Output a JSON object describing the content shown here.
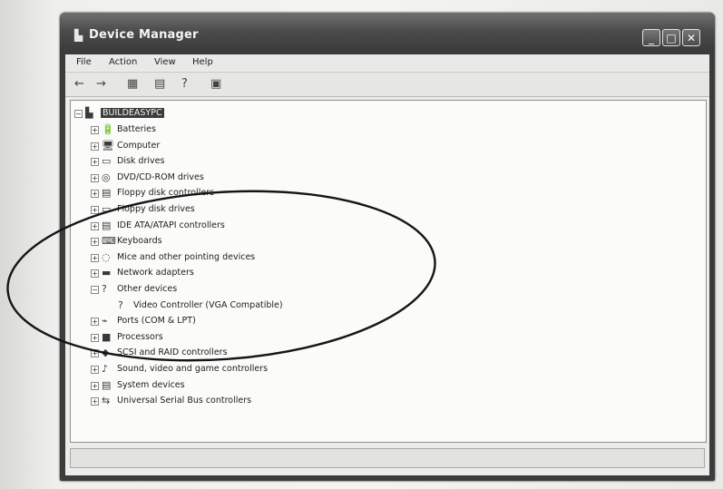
{
  "window": {
    "title": "Device Manager",
    "icon": "device-manager-icon",
    "controls": {
      "minimize": "_",
      "maximize": "□",
      "close": "✕"
    }
  },
  "menu": {
    "items": [
      "File",
      "Action",
      "View",
      "Help"
    ]
  },
  "toolbar": {
    "buttons": [
      {
        "name": "back",
        "glyph": "←"
      },
      {
        "name": "forward",
        "glyph": "→"
      },
      {
        "name": "properties",
        "glyph": "▦"
      },
      {
        "name": "print",
        "glyph": "▤"
      },
      {
        "name": "help",
        "glyph": "?"
      },
      {
        "name": "scan-hardware",
        "glyph": "▣"
      }
    ]
  },
  "tree": {
    "root": {
      "label": "BUILDEASYPC",
      "expander": "−",
      "icon": "computer-icon"
    },
    "nodes": [
      {
        "label": "Batteries",
        "expander": "+",
        "icon": "🔋",
        "level": 1
      },
      {
        "label": "Computer",
        "expander": "+",
        "icon": "🖥",
        "level": 1
      },
      {
        "label": "Disk drives",
        "expander": "+",
        "icon": "▭",
        "level": 1
      },
      {
        "label": "DVD/CD-ROM drives",
        "expander": "+",
        "icon": "◎",
        "level": 1
      },
      {
        "label": "Floppy disk controllers",
        "expander": "+",
        "icon": "▤",
        "level": 1
      },
      {
        "label": "Floppy disk drives",
        "expander": "+",
        "icon": "▭",
        "level": 1
      },
      {
        "label": "IDE ATA/ATAPI controllers",
        "expander": "+",
        "icon": "▤",
        "level": 1
      },
      {
        "label": "Keyboards",
        "expander": "+",
        "icon": "⌨",
        "level": 1
      },
      {
        "label": "Mice and other pointing devices",
        "expander": "+",
        "icon": "◌",
        "level": 1
      },
      {
        "label": "Network adapters",
        "expander": "+",
        "icon": "▬",
        "level": 1
      },
      {
        "label": "Other devices",
        "expander": "−",
        "icon": "?",
        "level": 1
      },
      {
        "label": "Video Controller (VGA Compatible)",
        "expander": "",
        "icon": "?",
        "level": 2
      },
      {
        "label": "Ports (COM & LPT)",
        "expander": "+",
        "icon": "⌁",
        "level": 1
      },
      {
        "label": "Processors",
        "expander": "+",
        "icon": "■",
        "level": 1
      },
      {
        "label": "SCSI and RAID controllers",
        "expander": "+",
        "icon": "◆",
        "level": 1
      },
      {
        "label": "Sound, video and game controllers",
        "expander": "+",
        "icon": "♪",
        "level": 1
      },
      {
        "label": "System devices",
        "expander": "+",
        "icon": "▤",
        "level": 1
      },
      {
        "label": "Universal Serial Bus controllers",
        "expander": "+",
        "icon": "⇆",
        "level": 1
      }
    ]
  },
  "annotation": {
    "shape": "ellipse",
    "color": "#111111",
    "marks": "highlight around Other devices group"
  }
}
